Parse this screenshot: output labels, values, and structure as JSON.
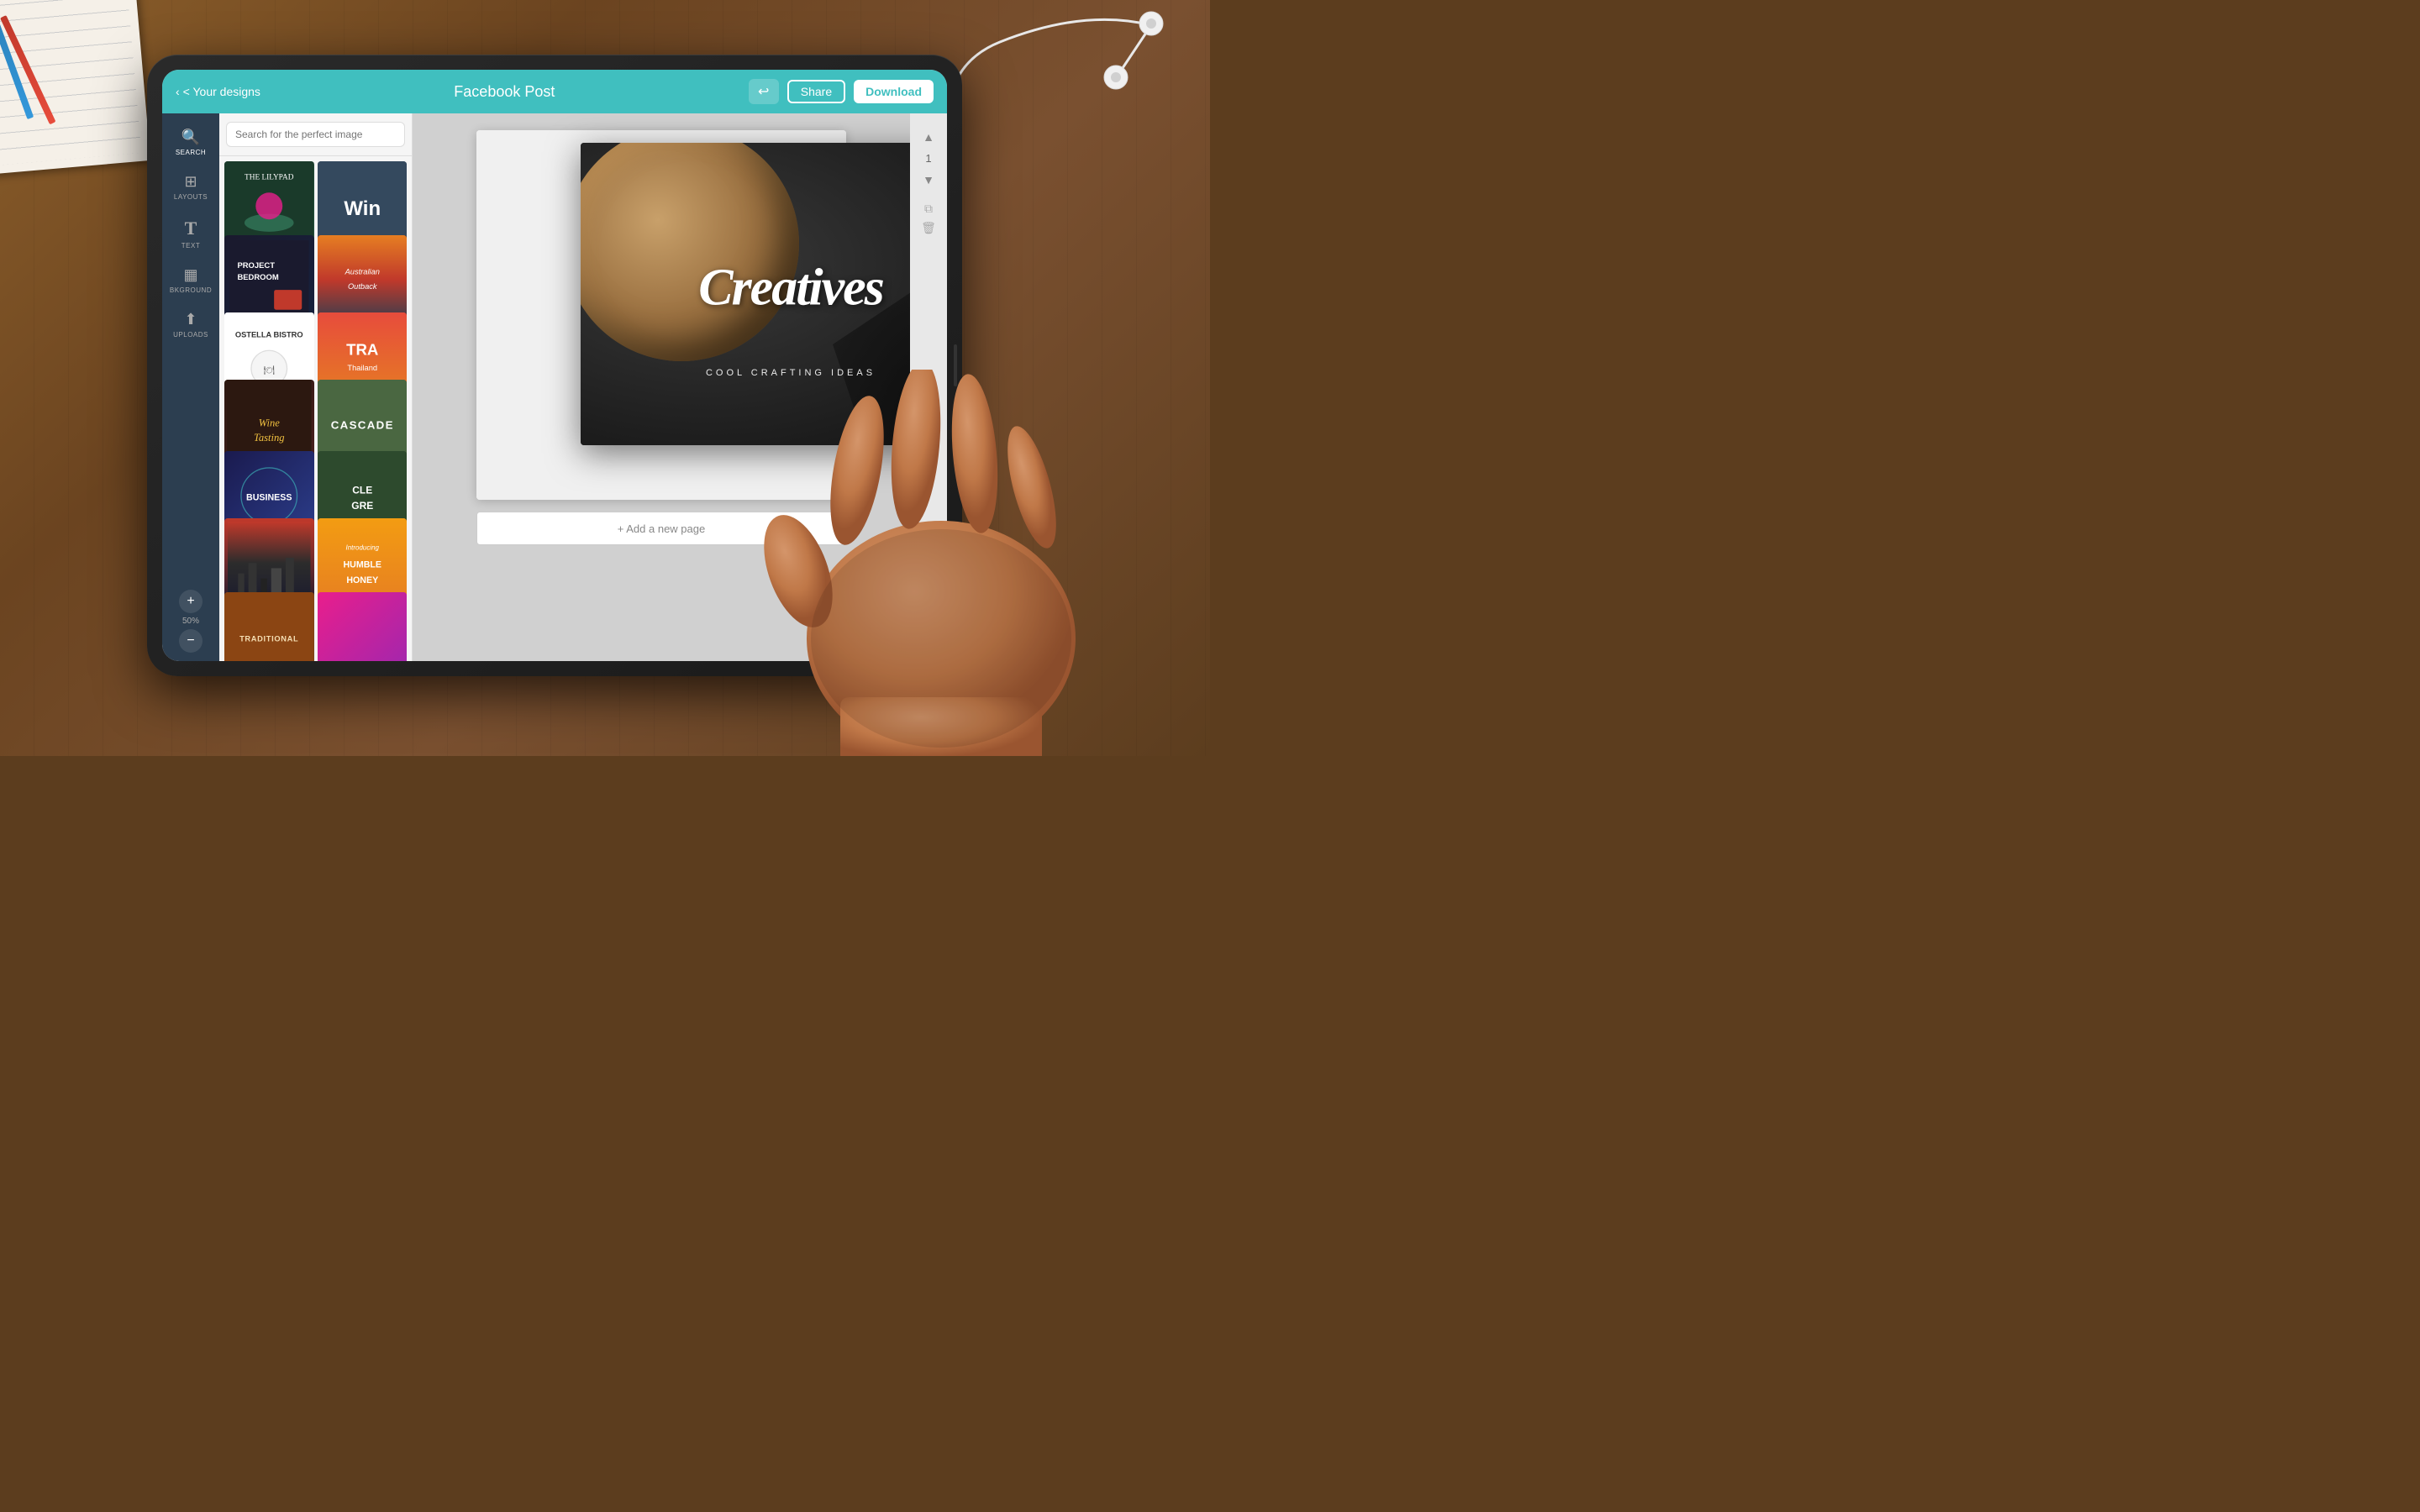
{
  "desk": {
    "bg_color": "#6b4420"
  },
  "topbar": {
    "back_label": "< Your designs",
    "title": "Facebook Post",
    "undo_icon": "↩",
    "share_label": "Share",
    "download_label": "Download"
  },
  "sidebar": {
    "items": [
      {
        "id": "search",
        "icon": "🔍",
        "label": "SEARCH"
      },
      {
        "id": "layouts",
        "icon": "⊞",
        "label": "LAYOUTS"
      },
      {
        "id": "text",
        "icon": "T",
        "label": "TEXT"
      },
      {
        "id": "background",
        "icon": "▦",
        "label": "BKGROUND"
      },
      {
        "id": "uploads",
        "icon": "↑",
        "label": "UPLOADS"
      }
    ],
    "zoom_plus": "+",
    "zoom_value": "50%",
    "zoom_minus": "−"
  },
  "search": {
    "placeholder": "Search for the perfect image"
  },
  "templates": [
    {
      "id": "lilypad",
      "label": "THE LILYPAD"
    },
    {
      "id": "win",
      "label": "Win"
    },
    {
      "id": "project",
      "label": "PROJECT BEDROOM"
    },
    {
      "id": "australia",
      "label": "Australian Outback"
    },
    {
      "id": "ostella",
      "label": "OSTELLA BISTRO"
    },
    {
      "id": "tra",
      "label": "TRA Thailand"
    },
    {
      "id": "wine",
      "label": "Wine Tasting"
    },
    {
      "id": "cascade",
      "label": "CASCADE"
    },
    {
      "id": "business",
      "label": "BUSINESS"
    },
    {
      "id": "cle",
      "label": "CLE GRE"
    },
    {
      "id": "city",
      "label": "City"
    },
    {
      "id": "humble",
      "label": "Introducing HUMBLE HONEY"
    },
    {
      "id": "traditional",
      "label": "TRADITIONAL"
    },
    {
      "id": "pink",
      "label": "Pink"
    }
  ],
  "canvas": {
    "add_page_label": "+ Add a new page"
  },
  "page_controls": {
    "up_icon": "▲",
    "page_number": "1",
    "down_icon": "▼",
    "copy_icon": "⧉",
    "delete_icon": "🗑"
  },
  "creatives": {
    "title": "Creatives",
    "subtitle": "COOL CRAFTING IDEAS"
  }
}
